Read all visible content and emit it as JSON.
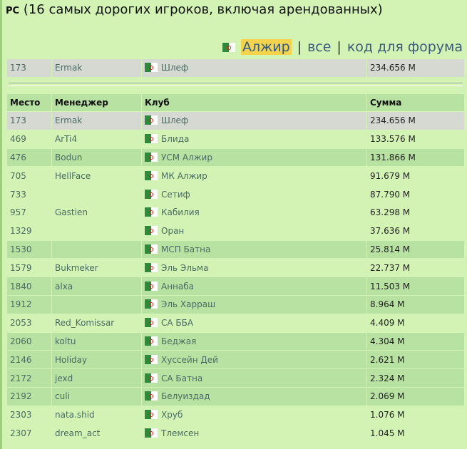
{
  "header": {
    "pc": "PC",
    "title": "(16 самых дорогих игроков, включая арендованных)"
  },
  "filter": {
    "active": "Алжир",
    "all": "все",
    "forum": "код для форума",
    "sep": "|"
  },
  "my_row": {
    "place": "173",
    "manager": "Ermak",
    "club": "Шлеф",
    "sum": "234.656 M"
  },
  "columns": {
    "place": "Место",
    "manager": "Менеджер",
    "club": "Клуб",
    "sum": "Сумма"
  },
  "rows": [
    {
      "place": "173",
      "manager": "Ermak",
      "club": "Шлеф",
      "sum": "234.656 M"
    },
    {
      "place": "469",
      "manager": "ArTi4",
      "club": "Блида",
      "sum": "133.576 M"
    },
    {
      "place": "476",
      "manager": "Bodun",
      "club": "УСМ Алжир",
      "sum": "131.866 M"
    },
    {
      "place": "705",
      "manager": "HellFace",
      "club": "МК Алжир",
      "sum": "91.679 M"
    },
    {
      "place": "733",
      "manager": "",
      "club": "Сетиф",
      "sum": "87.790 M"
    },
    {
      "place": "957",
      "manager": "Gastien",
      "club": "Кабилия",
      "sum": "63.298 M"
    },
    {
      "place": "1329",
      "manager": "",
      "club": "Оран",
      "sum": "37.636 M"
    },
    {
      "place": "1530",
      "manager": "",
      "club": "МСП Батна",
      "sum": "25.814 M"
    },
    {
      "place": "1579",
      "manager": "Bukmeker",
      "club": "Эль Эльма",
      "sum": "22.737 M"
    },
    {
      "place": "1840",
      "manager": "alxa",
      "club": "Аннаба",
      "sum": "11.503 M"
    },
    {
      "place": "1912",
      "manager": "",
      "club": "Эль Харраш",
      "sum": "8.964 M"
    },
    {
      "place": "2053",
      "manager": "Red_Komissar",
      "club": "СА ББА",
      "sum": "4.409 M"
    },
    {
      "place": "2060",
      "manager": "koltu",
      "club": "Беджая",
      "sum": "4.304 M"
    },
    {
      "place": "2146",
      "manager": "Holiday",
      "club": "Хуссейн Дей",
      "sum": "2.621 M"
    },
    {
      "place": "2172",
      "manager": "jexd",
      "club": "СА Батна",
      "sum": "2.324 M"
    },
    {
      "place": "2192",
      "manager": "culi",
      "club": "Белуиздад",
      "sum": "2.069 M"
    },
    {
      "place": "2303",
      "manager": "nata.shid",
      "club": "Хруб",
      "sum": "1.076 M"
    },
    {
      "place": "2307",
      "manager": "dream_act",
      "club": "Тлемсен",
      "sum": "1.045 M"
    }
  ],
  "colors": {
    "bg": "#d3f3b5",
    "alt_row": "#b8e2a2",
    "self_row": "#d6d9d1",
    "active_bg": "#f4d44d"
  },
  "icons": {
    "flag": "algeria-flag-icon"
  }
}
